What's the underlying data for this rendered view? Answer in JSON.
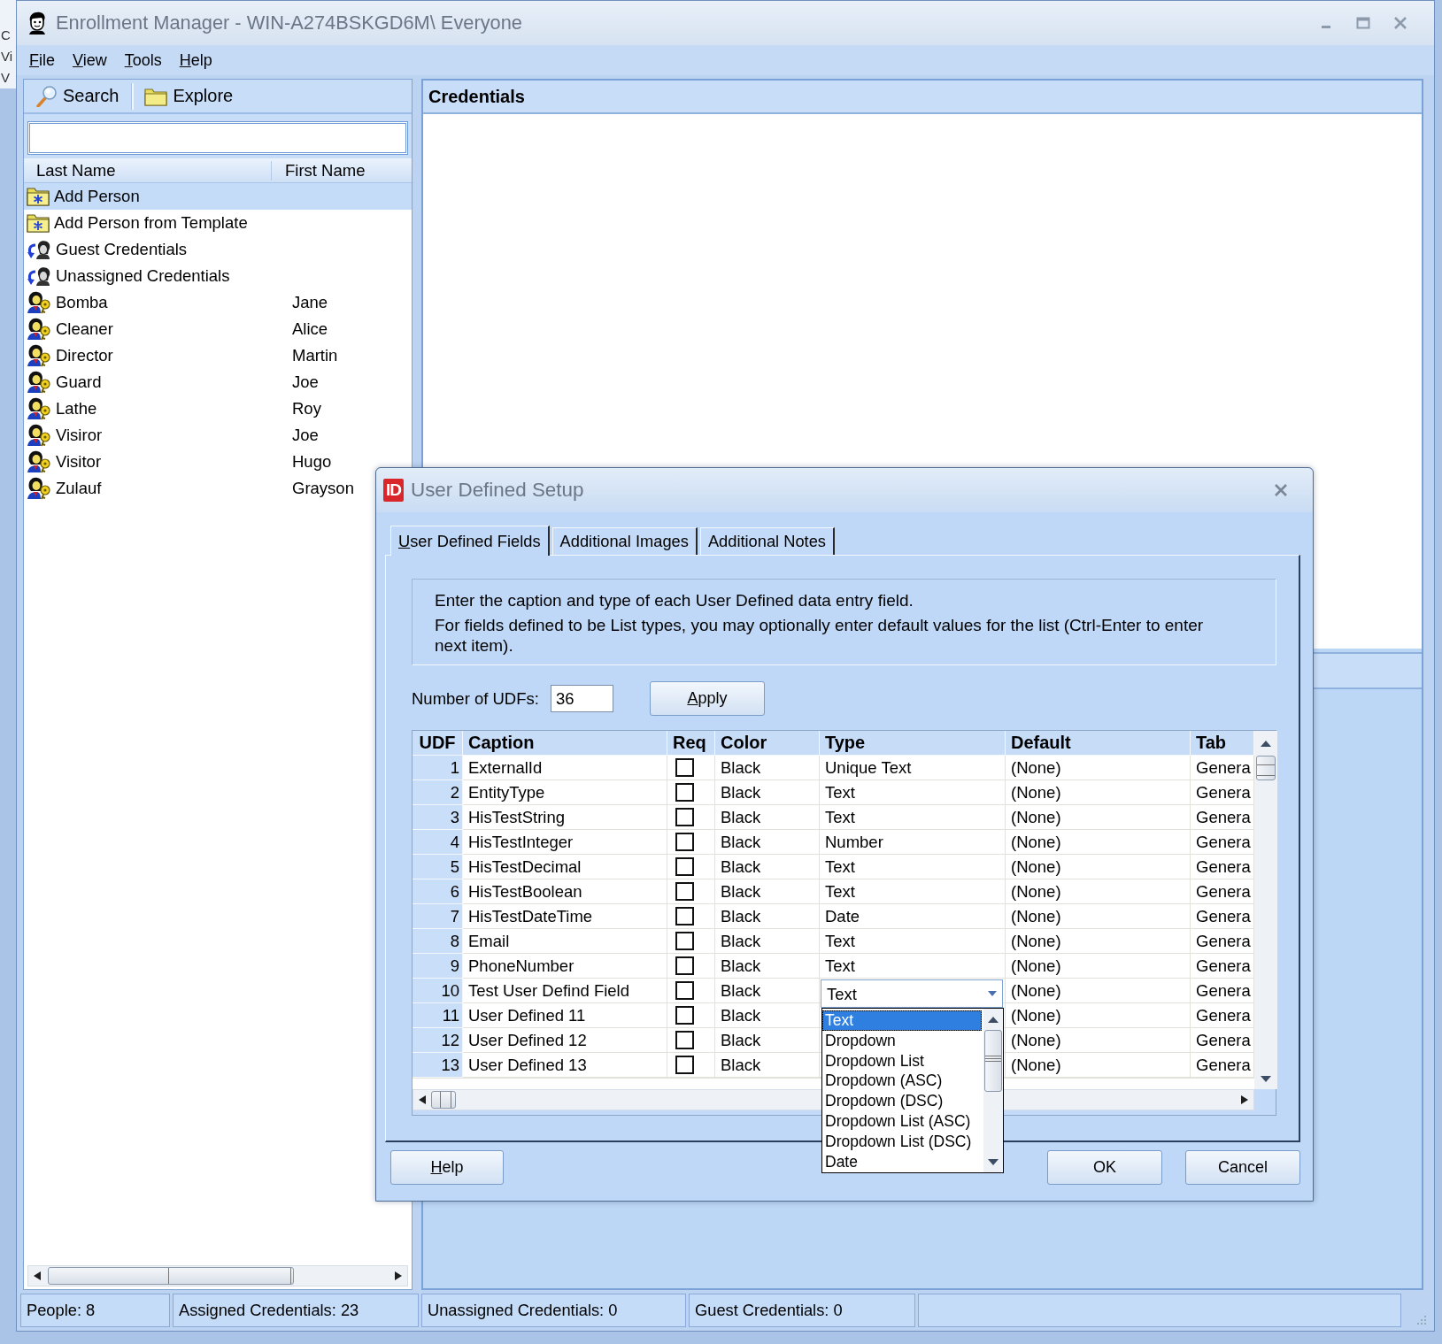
{
  "background_window": {
    "lines": [
      "C",
      "Vi",
      "V"
    ]
  },
  "window": {
    "title": "Enrollment Manager - WIN-A274BSKGD6M\\ Everyone"
  },
  "menu": [
    "File",
    "View",
    "Tools",
    "Help"
  ],
  "left_panel": {
    "toolbar": [
      {
        "label": "Search",
        "kind": "search"
      },
      {
        "label": "Explore",
        "kind": "explore"
      }
    ],
    "list": {
      "columns": [
        "Last Name",
        "First Name"
      ],
      "rows": [
        {
          "kind": "add",
          "last_name": "Add Person",
          "selected": true
        },
        {
          "kind": "add",
          "last_name": "Add Person from Template",
          "selected": false
        },
        {
          "kind": "credentials",
          "last_name": "Guest Credentials",
          "selected": false
        },
        {
          "kind": "credentials",
          "last_name": "Unassigned Credentials",
          "selected": false
        },
        {
          "kind": "person",
          "last_name": "Bomba",
          "first_name": "Jane",
          "selected": false
        },
        {
          "kind": "person",
          "last_name": "Cleaner",
          "first_name": "Alice",
          "selected": false
        },
        {
          "kind": "person",
          "last_name": "Director",
          "first_name": "Martin",
          "selected": false
        },
        {
          "kind": "person",
          "last_name": "Guard",
          "first_name": "Joe",
          "selected": false
        },
        {
          "kind": "person",
          "last_name": "Lathe",
          "first_name": "Roy",
          "selected": false
        },
        {
          "kind": "person",
          "last_name": "Visiror",
          "first_name": "Joe",
          "selected": false
        },
        {
          "kind": "person",
          "last_name": "Visitor",
          "first_name": "Hugo",
          "selected": false
        },
        {
          "kind": "person",
          "last_name": "Zulauf",
          "first_name": "Grayson",
          "selected": false
        }
      ]
    }
  },
  "right_panel": {
    "title": "Credentials"
  },
  "dialog": {
    "logo": "ID",
    "title": "User Defined Setup",
    "tabs": [
      {
        "label": "User Defined Fields",
        "selected": true,
        "access_key": true
      },
      {
        "label": "Additional Images",
        "selected": false,
        "access_key": false
      },
      {
        "label": "Additional Notes",
        "selected": false,
        "access_key": false
      }
    ],
    "info": [
      "Enter the caption and type of each User Defined data entry field.",
      "For fields defined to be List types, you may optionally enter default values for the list (Ctrl-Enter to enter next item)."
    ],
    "udf_count": {
      "label": "Number of UDFs:",
      "value": "36"
    },
    "apply_button": {
      "label": "Apply",
      "access_key": true
    },
    "grid": {
      "columns": [
        "UDF",
        "Caption",
        "Req",
        "Color",
        "Type",
        "Default",
        "Tab"
      ],
      "rows": [
        {
          "udf": "1",
          "caption": "ExternalId",
          "required": false,
          "shade": "Black",
          "type": "Unique Text",
          "default": "(None)",
          "tab": "Genera",
          "editing": false
        },
        {
          "udf": "2",
          "caption": "EntityType",
          "required": false,
          "shade": "Black",
          "type": "Text",
          "default": "(None)",
          "tab": "Genera",
          "editing": false
        },
        {
          "udf": "3",
          "caption": "HisTestString",
          "required": false,
          "shade": "Black",
          "type": "Text",
          "default": "(None)",
          "tab": "Genera",
          "editing": false
        },
        {
          "udf": "4",
          "caption": "HisTestInteger",
          "required": false,
          "shade": "Black",
          "type": "Number",
          "default": "(None)",
          "tab": "Genera",
          "editing": false
        },
        {
          "udf": "5",
          "caption": "HisTestDecimal",
          "required": false,
          "shade": "Black",
          "type": "Text",
          "default": "(None)",
          "tab": "Genera",
          "editing": false
        },
        {
          "udf": "6",
          "caption": "HisTestBoolean",
          "required": false,
          "shade": "Black",
          "type": "Text",
          "default": "(None)",
          "tab": "Genera",
          "editing": false
        },
        {
          "udf": "7",
          "caption": "HisTestDateTime",
          "required": false,
          "shade": "Black",
          "type": "Date",
          "default": "(None)",
          "tab": "Genera",
          "editing": false
        },
        {
          "udf": "8",
          "caption": "Email",
          "required": false,
          "shade": "Black",
          "type": "Text",
          "default": "(None)",
          "tab": "Genera",
          "editing": false
        },
        {
          "udf": "9",
          "caption": "PhoneNumber",
          "required": false,
          "shade": "Black",
          "type": "Text",
          "default": "(None)",
          "tab": "Genera",
          "editing": false
        },
        {
          "udf": "10",
          "caption": "Test User Defind Field",
          "required": false,
          "shade": "Black",
          "type": "Text",
          "default": "(None)",
          "tab": "Genera",
          "editing": true
        },
        {
          "udf": "11",
          "caption": "User Defined 11",
          "required": false,
          "shade": "Black",
          "default": "(None)",
          "tab": "Genera",
          "editing": false
        },
        {
          "udf": "12",
          "caption": "User Defined 12",
          "required": false,
          "shade": "Black",
          "default": "(None)",
          "tab": "Genera",
          "editing": false
        },
        {
          "udf": "13",
          "caption": "User Defined 13",
          "required": false,
          "shade": "Black",
          "default": "(None)",
          "tab": "Genera",
          "editing": false
        }
      ],
      "type_dropdown": {
        "options": [
          {
            "label": "Text",
            "selected": true
          },
          {
            "label": "Dropdown",
            "selected": false
          },
          {
            "label": "Dropdown List",
            "selected": false
          },
          {
            "label": "Dropdown (ASC)",
            "selected": false
          },
          {
            "label": "Dropdown (DSC)",
            "selected": false
          },
          {
            "label": "Dropdown List (ASC)",
            "selected": false
          },
          {
            "label": "Dropdown List (DSC)",
            "selected": false
          },
          {
            "label": "Date",
            "selected": false
          }
        ]
      }
    },
    "buttons": [
      {
        "label": "Help",
        "access_key": true
      },
      {
        "label": "OK",
        "access_key": false
      },
      {
        "label": "Cancel",
        "access_key": false
      }
    ]
  },
  "status_bar": [
    "People: 8",
    "Assigned Credentials: 23",
    "Unassigned Credentials: 0",
    "Guest Credentials: 0"
  ]
}
